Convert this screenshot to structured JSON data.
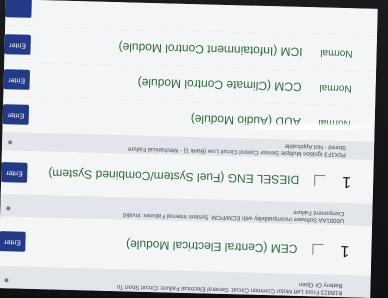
{
  "modules": [
    {
      "name": "ICM (Infotainment Control Module)",
      "status": "Normal",
      "button": "Enter"
    },
    {
      "name": "CCM (Climate Control Module)",
      "status": "Normal",
      "button": "Enter"
    },
    {
      "name": "AUD (Audio Module)",
      "status": "Normal",
      "button": "Enter"
    },
    {
      "name": "DIESEL ENG (Fuel System/Combined System)",
      "count": "1",
      "button": "Enter"
    },
    {
      "name": "CEM (Central Electrical Module)",
      "count": "1",
      "button": "Enter"
    }
  ],
  "faults": {
    "aud": "P0X1F3 Ignition Multiple Sensor Control Circuit Low (Bank 1) - Mechanical Failure",
    "aud_2": "Stored - Not Applicable",
    "diesel": "U0001AA Software incompatibility with ECM/PCM: System Internal Failures: Invalid",
    "diesel_2": "Component Failure",
    "cem": "B1B823 Front Left Motor Common Circuit: General Electrical Failure: Circuit Short To",
    "cem_2": "Battery Or Open"
  },
  "colors": {
    "button": "#243a86",
    "status_text": "#2f6a3a"
  }
}
